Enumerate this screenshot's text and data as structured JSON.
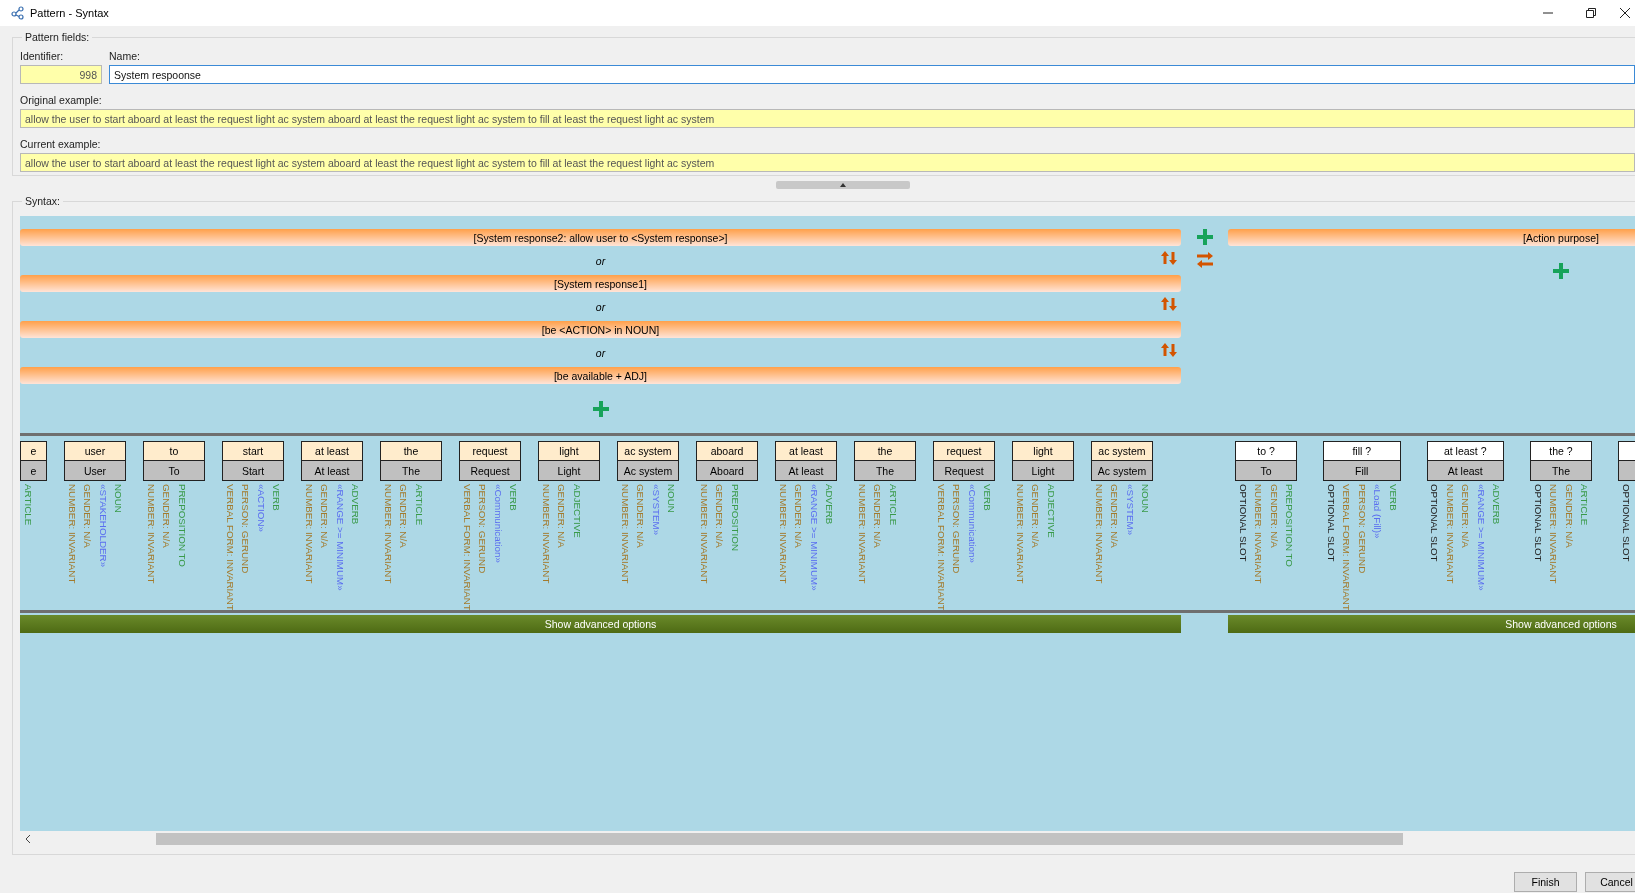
{
  "window": {
    "title": "Pattern - Syntax"
  },
  "pattern_fields": {
    "legend": "Pattern fields:",
    "identifier": {
      "label": "Identifier:",
      "value": "998"
    },
    "name": {
      "label": "Name:",
      "value": "System respoonse"
    },
    "original_example": {
      "label": "Original example:",
      "value": "allow the user to start aboard at least the request light ac system aboard at least the request light ac system to fill at least the request light ac system"
    },
    "current_example": {
      "label": "Current example:",
      "value": "allow the user to start aboard at least the request light ac system aboard at least the request light ac system to fill at least the request light ac system"
    }
  },
  "syntax": {
    "legend": "Syntax:",
    "groups": [
      {
        "options": [
          {
            "text": "[System response2: allow user to <System response>]",
            "connector": "or"
          },
          {
            "text": "[System response1]",
            "connector": "or"
          },
          {
            "text": "[be <ACTION> in NOUN]",
            "connector": "or"
          },
          {
            "text": "[be available + ADJ]"
          }
        ],
        "tokens": [
          {
            "word": "e",
            "lemma": "e",
            "optional": false,
            "clipped": true,
            "attributes": [
              {
                "kind": "category",
                "text": "ARTICLE"
              }
            ]
          },
          {
            "word": "user",
            "lemma": "User",
            "optional": false,
            "attributes": [
              {
                "kind": "grammar",
                "text": "NUMBER: INVARIANT"
              },
              {
                "kind": "grammar",
                "text": "GENDER: N/A"
              },
              {
                "kind": "semantic",
                "text": "«STAKEHOLDER»"
              },
              {
                "kind": "category",
                "text": "NOUN"
              }
            ]
          },
          {
            "word": "to",
            "lemma": "To",
            "optional": false,
            "attributes": [
              {
                "kind": "grammar",
                "text": "NUMBER: INVARIANT"
              },
              {
                "kind": "grammar",
                "text": "GENDER: N/A"
              },
              {
                "kind": "category",
                "text": "PREPOSITION TO"
              }
            ]
          },
          {
            "word": "start",
            "lemma": "Start",
            "optional": false,
            "attributes": [
              {
                "kind": "grammar",
                "text": "VERBAL FORM: INVARIANT"
              },
              {
                "kind": "grammar",
                "text": "PERSON: GERUND"
              },
              {
                "kind": "semantic",
                "text": "«ACTION»"
              },
              {
                "kind": "category",
                "text": "VERB"
              }
            ]
          },
          {
            "word": "at least",
            "lemma": "At least",
            "optional": false,
            "attributes": [
              {
                "kind": "grammar",
                "text": "NUMBER: INVARIANT"
              },
              {
                "kind": "grammar",
                "text": "GENDER: N/A"
              },
              {
                "kind": "semantic",
                "text": "«RANGE >= MINIMUM»"
              },
              {
                "kind": "category",
                "text": "ADVERB"
              }
            ]
          },
          {
            "word": "the",
            "lemma": "The",
            "optional": false,
            "attributes": [
              {
                "kind": "grammar",
                "text": "NUMBER: INVARIANT"
              },
              {
                "kind": "grammar",
                "text": "GENDER: N/A"
              },
              {
                "kind": "category",
                "text": "ARTICLE"
              }
            ]
          },
          {
            "word": "request",
            "lemma": "Request",
            "optional": false,
            "attributes": [
              {
                "kind": "grammar",
                "text": "VERBAL FORM: INVARIANT"
              },
              {
                "kind": "grammar",
                "text": "PERSON: GERUND"
              },
              {
                "kind": "semantic",
                "text": "«Communication»"
              },
              {
                "kind": "category",
                "text": "VERB"
              }
            ]
          },
          {
            "word": "light",
            "lemma": "Light",
            "optional": false,
            "attributes": [
              {
                "kind": "grammar",
                "text": "NUMBER: INVARIANT"
              },
              {
                "kind": "grammar",
                "text": "GENDER: N/A"
              },
              {
                "kind": "category",
                "text": "ADJECTIVE"
              }
            ]
          },
          {
            "word": "ac system",
            "lemma": "Ac system",
            "optional": false,
            "attributes": [
              {
                "kind": "grammar",
                "text": "NUMBER: INVARIANT"
              },
              {
                "kind": "grammar",
                "text": "GENDER: N/A"
              },
              {
                "kind": "semantic",
                "text": "«SYSTEM»"
              },
              {
                "kind": "category",
                "text": "NOUN"
              }
            ]
          },
          {
            "word": "aboard",
            "lemma": "Aboard",
            "optional": false,
            "attributes": [
              {
                "kind": "grammar",
                "text": "NUMBER: INVARIANT"
              },
              {
                "kind": "grammar",
                "text": "GENDER: N/A"
              },
              {
                "kind": "category",
                "text": "PREPOSITION"
              }
            ]
          },
          {
            "word": "at least",
            "lemma": "At least",
            "optional": false,
            "attributes": [
              {
                "kind": "grammar",
                "text": "NUMBER: INVARIANT"
              },
              {
                "kind": "grammar",
                "text": "GENDER: N/A"
              },
              {
                "kind": "semantic",
                "text": "«RANGE >= MINIMUM»"
              },
              {
                "kind": "category",
                "text": "ADVERB"
              }
            ]
          },
          {
            "word": "the",
            "lemma": "The",
            "optional": false,
            "attributes": [
              {
                "kind": "grammar",
                "text": "NUMBER: INVARIANT"
              },
              {
                "kind": "grammar",
                "text": "GENDER: N/A"
              },
              {
                "kind": "category",
                "text": "ARTICLE"
              }
            ]
          },
          {
            "word": "request",
            "lemma": "Request",
            "optional": false,
            "attributes": [
              {
                "kind": "grammar",
                "text": "VERBAL FORM: INVARIANT"
              },
              {
                "kind": "grammar",
                "text": "PERSON: GERUND"
              },
              {
                "kind": "semantic",
                "text": "«Communication»"
              },
              {
                "kind": "category",
                "text": "VERB"
              }
            ]
          },
          {
            "word": "light",
            "lemma": "Light",
            "optional": false,
            "attributes": [
              {
                "kind": "grammar",
                "text": "NUMBER: INVARIANT"
              },
              {
                "kind": "grammar",
                "text": "GENDER: N/A"
              },
              {
                "kind": "category",
                "text": "ADJECTIVE"
              }
            ]
          },
          {
            "word": "ac system",
            "lemma": "Ac system",
            "optional": false,
            "attributes": [
              {
                "kind": "grammar",
                "text": "NUMBER: INVARIANT"
              },
              {
                "kind": "grammar",
                "text": "GENDER: N/A"
              },
              {
                "kind": "semantic",
                "text": "«SYSTEM»"
              },
              {
                "kind": "category",
                "text": "NOUN"
              }
            ]
          }
        ],
        "advanced_button": "Show advanced options"
      },
      {
        "options": [
          {
            "text": "[Action purpose]"
          }
        ],
        "tokens": [
          {
            "word": "to ?",
            "lemma": "To",
            "optional": true,
            "attributes": [
              {
                "kind": "slot",
                "text": "OPTIONAL SLOT"
              },
              {
                "kind": "grammar",
                "text": "NUMBER: INVARIANT"
              },
              {
                "kind": "grammar",
                "text": "GENDER: N/A"
              },
              {
                "kind": "category",
                "text": "PREPOSITION TO"
              }
            ]
          },
          {
            "word": "fill ?",
            "lemma": "Fill",
            "optional": true,
            "attributes": [
              {
                "kind": "slot",
                "text": "OPTIONAL SLOT"
              },
              {
                "kind": "grammar",
                "text": "VERBAL FORM: INVARIANT"
              },
              {
                "kind": "grammar",
                "text": "PERSON: GERUND"
              },
              {
                "kind": "semantic",
                "text": "«Load (Fill)»"
              },
              {
                "kind": "category",
                "text": "VERB"
              }
            ]
          },
          {
            "word": "at least ?",
            "lemma": "At least",
            "optional": true,
            "attributes": [
              {
                "kind": "slot",
                "text": "OPTIONAL SLOT"
              },
              {
                "kind": "grammar",
                "text": "NUMBER: INVARIANT"
              },
              {
                "kind": "grammar",
                "text": "GENDER: N/A"
              },
              {
                "kind": "semantic",
                "text": "«RANGE >= MINIMUM»"
              },
              {
                "kind": "category",
                "text": "ADVERB"
              }
            ]
          },
          {
            "word": "the ?",
            "lemma": "The",
            "optional": true,
            "attributes": [
              {
                "kind": "slot",
                "text": "OPTIONAL SLOT"
              },
              {
                "kind": "grammar",
                "text": "NUMBER: INVARIANT"
              },
              {
                "kind": "grammar",
                "text": "GENDER: N/A"
              },
              {
                "kind": "category",
                "text": "ARTICLE"
              }
            ]
          },
          {
            "optional": true,
            "attributes": [
              {
                "kind": "slot",
                "text": "OPTIONAL SLOT"
              }
            ]
          }
        ],
        "advanced_button": "Show advanced options"
      }
    ]
  },
  "buttons": [
    "Finish",
    "Cancel"
  ]
}
